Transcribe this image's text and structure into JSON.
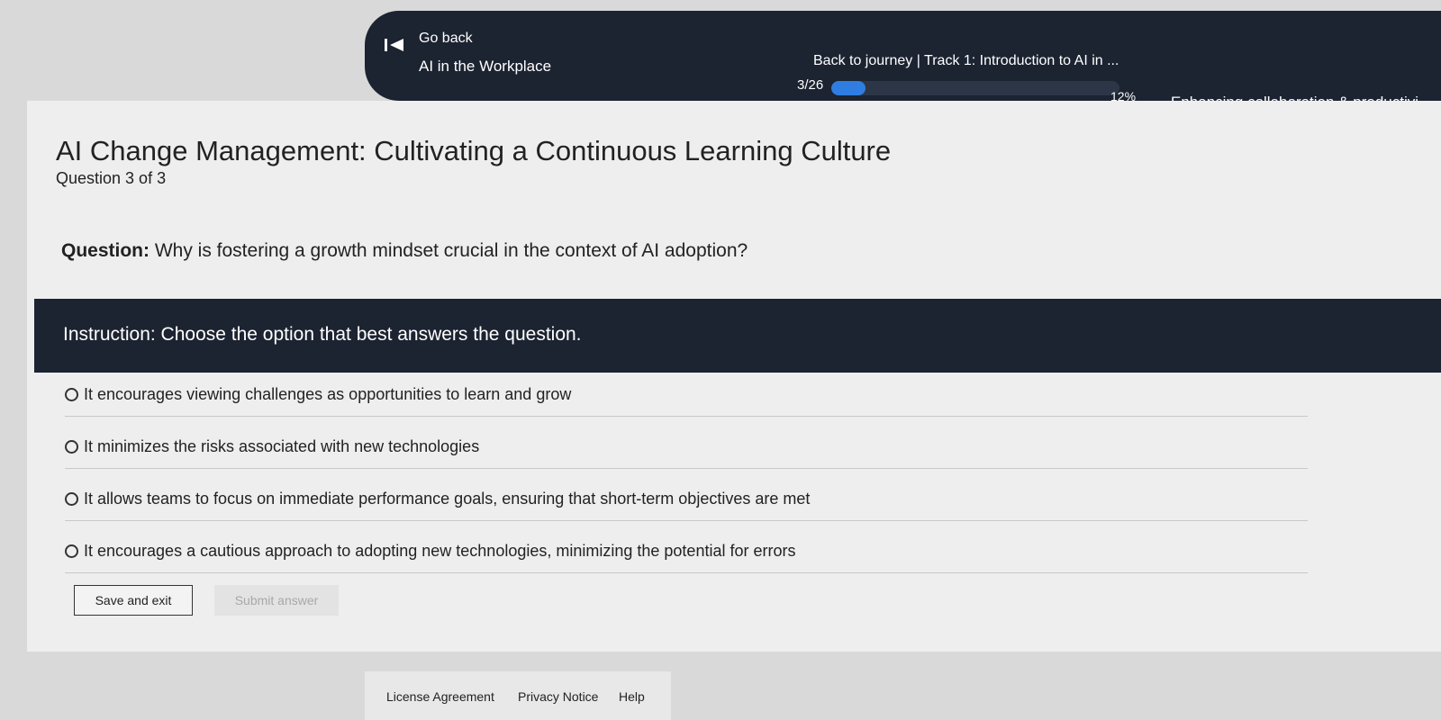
{
  "header": {
    "go_back": "Go back",
    "course_title": "AI in the Workplace",
    "journey": "Back to journey  |  Track 1: Introduction to AI in ...",
    "step": "3/26",
    "progress_percent": 12,
    "progress_label": "12%",
    "topic": "Enhancing collaboration & productivi"
  },
  "main": {
    "title": "AI Change Management: Cultivating a Continuous Learning Culture",
    "question_count": "Question 3 of 3",
    "question_prefix": "Question:",
    "question_text": " Why is fostering a growth mindset crucial in the context of AI adoption?",
    "instruction": "Instruction: Choose the option that best answers the question.",
    "options": [
      "It encourages viewing challenges as opportunities to learn and grow",
      "It minimizes the risks associated with new technologies",
      "It allows teams to focus on immediate performance goals, ensuring that short-term objectives are met",
      "It encourages a cautious approach to adopting new technologies, minimizing the potential for errors"
    ],
    "save_label": "Save and exit",
    "submit_label": "Submit answer"
  },
  "footer": {
    "license": "License Agreement",
    "privacy": "Privacy Notice",
    "help": "Help"
  }
}
